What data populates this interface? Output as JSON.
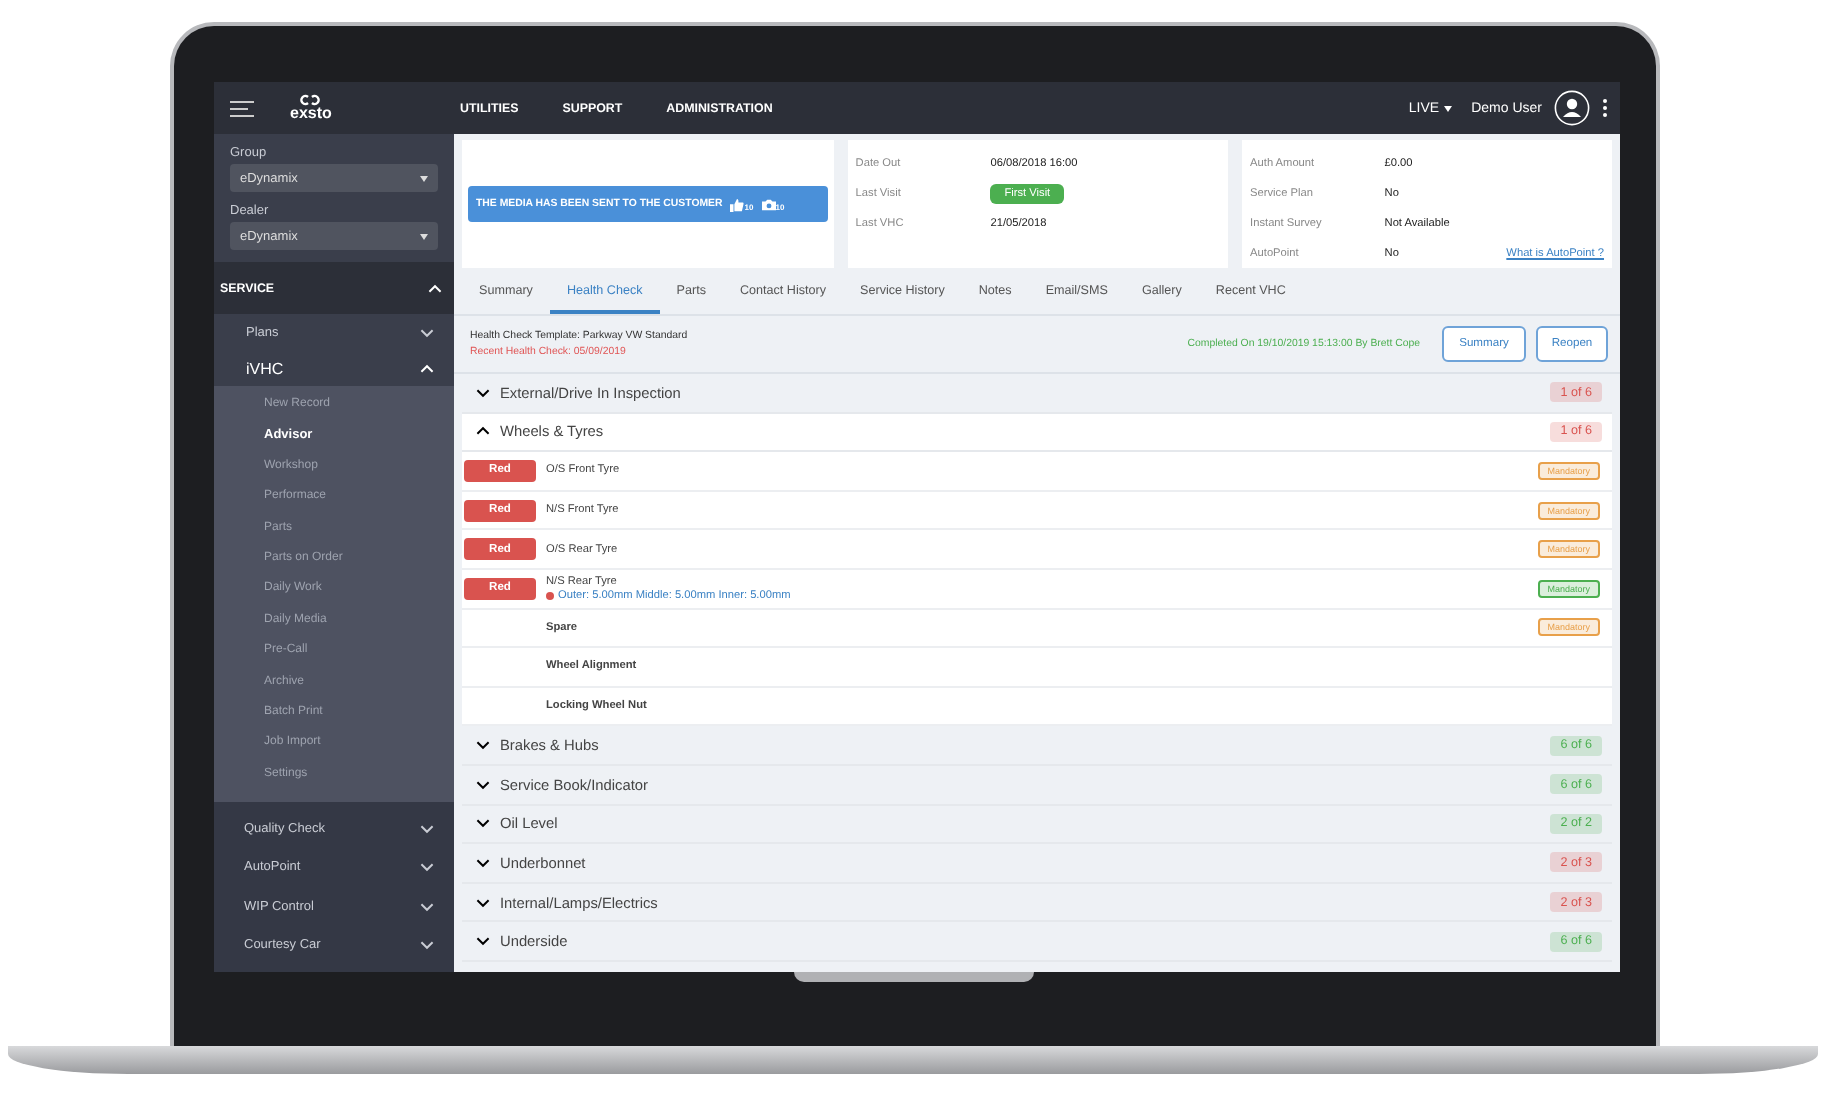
{
  "logo": {
    "text": "exsto"
  },
  "nav": [
    "UTILITIES",
    "SUPPORT",
    "ADMINISTRATION"
  ],
  "environment": "LIVE",
  "user": "Demo User",
  "sidebar": {
    "group_label": "Group",
    "group_value": "eDynamix",
    "dealer_label": "Dealer",
    "dealer_value": "eDynamix",
    "sections": [
      {
        "label": "SERVICE",
        "expanded": true,
        "children": [
          {
            "label": "Plans",
            "expanded": false
          },
          {
            "label": "iVHC",
            "expanded": true,
            "children": [
              {
                "label": "New Record",
                "selected": false
              },
              {
                "label": "Advisor",
                "selected": true
              },
              {
                "label": "Workshop",
                "selected": false
              },
              {
                "label": "Performace",
                "selected": false
              },
              {
                "label": "Parts",
                "selected": false
              },
              {
                "label": "Parts on Order",
                "selected": false
              },
              {
                "label": "Daily Work",
                "selected": false
              },
              {
                "label": "Daily Media",
                "selected": false
              },
              {
                "label": "Pre-Call",
                "selected": false
              },
              {
                "label": "Archive",
                "selected": false
              },
              {
                "label": "Batch Print",
                "selected": false
              },
              {
                "label": "Job Import",
                "selected": false
              },
              {
                "label": "Settings",
                "selected": false
              }
            ]
          }
        ]
      },
      {
        "label": "Quality Check",
        "expanded": false
      },
      {
        "label": "AutoPoint",
        "expanded": false
      },
      {
        "label": "WIP Control",
        "expanded": false
      },
      {
        "label": "Courtesy Car",
        "expanded": false
      }
    ]
  },
  "media_banner": {
    "text": "THE MEDIA HAS BEEN SENT TO THE CUSTOMER",
    "likes": "10",
    "photos": "10"
  },
  "visit_card": [
    {
      "label": "Date Out",
      "value": "06/08/2018 16:00",
      "kind": "text"
    },
    {
      "label": "Last Visit",
      "value": "First Visit",
      "kind": "badge"
    },
    {
      "label": "Last VHC",
      "value": "21/05/2018",
      "kind": "text"
    }
  ],
  "auth_card": [
    {
      "label": "Auth Amount",
      "value": "£0.00"
    },
    {
      "label": "Service Plan",
      "value": "No"
    },
    {
      "label": "Instant Survey",
      "value": "Not Available"
    },
    {
      "label": "AutoPoint",
      "value": "No",
      "link": "What is AutoPoint ?"
    }
  ],
  "tabs": [
    {
      "label": "Summary",
      "selected": false
    },
    {
      "label": "Health Check",
      "selected": true
    },
    {
      "label": "Parts",
      "selected": false
    },
    {
      "label": "Contact History",
      "selected": false
    },
    {
      "label": "Service History",
      "selected": false
    },
    {
      "label": "Notes",
      "selected": false
    },
    {
      "label": "Email/SMS",
      "selected": false
    },
    {
      "label": "Gallery",
      "selected": false
    },
    {
      "label": "Recent VHC",
      "selected": false
    }
  ],
  "health_check": {
    "template": "Health Check Template: Parkway VW Standard",
    "recent": "Recent Health Check: 05/09/2019",
    "completed": "Completed On 19/10/2019 15:13:00 By Brett Cope",
    "buttons": [
      "Summary",
      "Reopen"
    ],
    "sections": [
      {
        "title": "External/Drive In Inspection",
        "count": "1 of 6",
        "color": "#d9534f",
        "expanded": false
      },
      {
        "title": "Wheels & Tyres",
        "count": "1 of 6",
        "color": "#d9534f",
        "expanded": true,
        "items": [
          {
            "rating": "Red",
            "name": "O/S Front Tyre",
            "tag": "Mandatory",
            "color": "#e8a04a"
          },
          {
            "rating": "Red",
            "name": "N/S Front Tyre",
            "tag": "Mandatory",
            "color": "#e8a04a"
          },
          {
            "rating": "Red",
            "name": "O/S Rear Tyre",
            "tag": "Mandatory",
            "color": "#e8a04a"
          },
          {
            "rating": "Red",
            "name": "N/S Rear Tyre",
            "detail": "Outer: 5.00mm Middle: 5.00mm Inner: 5.00mm",
            "tag": "Mandatory",
            "color": "#4caf50"
          },
          {
            "name": "Spare",
            "tag": "Mandatory",
            "color": "#e8a04a"
          },
          {
            "name": "Wheel Alignment"
          },
          {
            "name": "Locking Wheel Nut"
          }
        ]
      },
      {
        "title": "Brakes & Hubs",
        "count": "6 of 6",
        "color": "#4caf50",
        "expanded": false
      },
      {
        "title": "Service Book/Indicator",
        "count": "6 of 6",
        "color": "#4caf50",
        "expanded": false
      },
      {
        "title": "Oil Level",
        "count": "2 of 2",
        "color": "#4caf50",
        "expanded": false
      },
      {
        "title": "Underbonnet",
        "count": "2 of 3",
        "color": "#d9534f",
        "expanded": false
      },
      {
        "title": "Internal/Lamps/Electrics",
        "count": "2 of 3",
        "color": "#d9534f",
        "expanded": false
      },
      {
        "title": "Underside",
        "count": "6 of 6",
        "color": "#4caf50",
        "expanded": false
      }
    ]
  }
}
